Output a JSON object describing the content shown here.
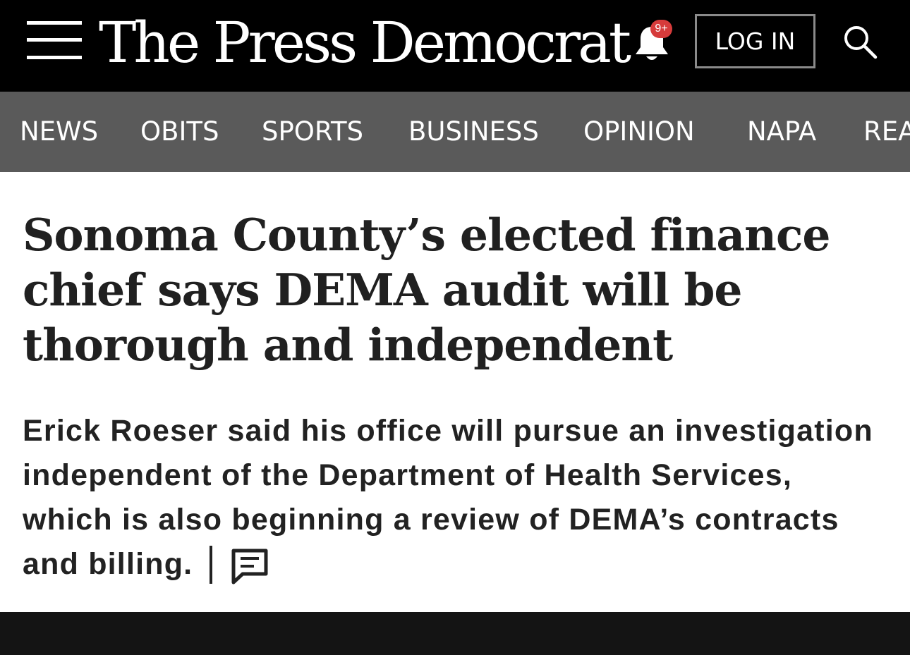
{
  "header": {
    "brand_name": "The Press Democrat",
    "notification_badge": "9+",
    "login_label": "LOG IN",
    "icons": {
      "menu": "hamburger-menu-icon",
      "notifications": "bell-icon",
      "search": "search-icon"
    }
  },
  "nav": {
    "items": [
      {
        "label": "NEWS"
      },
      {
        "label": "OBITS"
      },
      {
        "label": "SPORTS"
      },
      {
        "label": "BUSINESS"
      },
      {
        "label": "OPINION"
      },
      {
        "label": "NAPA"
      },
      {
        "label": "REA"
      }
    ]
  },
  "article": {
    "headline": "Sonoma County’s elected finance chief says DEMA audit will be thorough and independent",
    "dek": "Erick Roeser said his office will pursue an investigation independent of the Department of Health Services, which is also beginning a review of DEMA’s contracts and billing.",
    "comment_icon": "comment-icon"
  },
  "colors": {
    "header_bg": "#000000",
    "nav_bg": "#5a5a5a",
    "badge": "#d63b3b",
    "text": "#202020",
    "footer_bg": "#141414"
  }
}
